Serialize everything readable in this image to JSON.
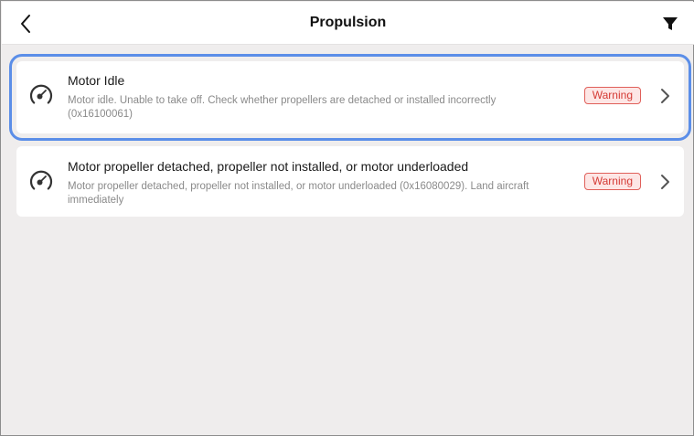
{
  "header": {
    "title": "Propulsion",
    "back_icon": "chevron-left-icon",
    "filter_icon": "filter-icon"
  },
  "colors": {
    "accent_selection": "#5b8ee8",
    "warning_text": "#d43b35",
    "warning_bg": "#fde6e5",
    "background": "#efeded"
  },
  "alerts": [
    {
      "icon": "motor-gauge-icon",
      "title": "Motor Idle",
      "description": "Motor idle. Unable to take off. Check whether propellers are detached or installed incorrectly (0x16100061)",
      "badge": "Warning",
      "selected": true
    },
    {
      "icon": "motor-gauge-icon",
      "title": "Motor propeller detached, propeller not installed, or motor underloaded",
      "description": "Motor propeller detached, propeller not installed, or motor underloaded (0x16080029). Land aircraft immediately",
      "badge": "Warning",
      "selected": false
    }
  ]
}
